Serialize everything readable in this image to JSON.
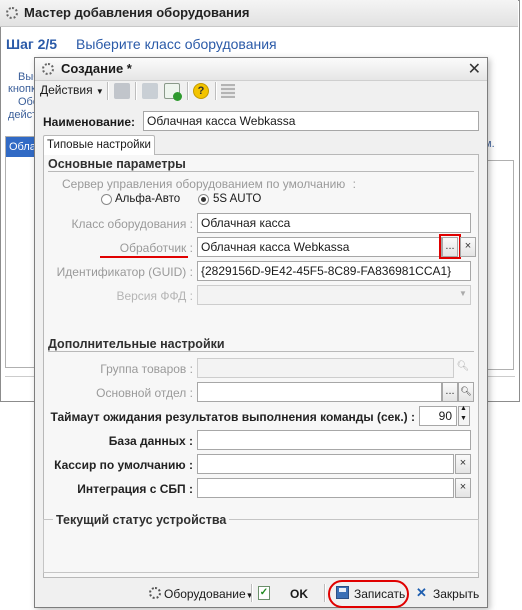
{
  "wizard": {
    "title": "Мастер добавления оборудования",
    "step": "Шаг 2/5",
    "step_text": "Выберите класс оборудования",
    "frag1": "Выб",
    "frag2": "кнопк",
    "frag3": "Обо",
    "frag4": "дейст",
    "frag_right": "м.",
    "left_selected": "Облач"
  },
  "dialog": {
    "title": "Создание *",
    "actions_label": "Действия",
    "name_label": "Наименование:",
    "name_value": "Облачная касса Webkassa",
    "tab_label": "Типовые настройки",
    "main_section": "Основные параметры",
    "server_label": "Сервер управления оборудованием по умолчанию",
    "radio1": "Альфа-Авто",
    "radio2": "5S AUTO",
    "class_label": "Класс оборудования",
    "class_value": "Облачная касса",
    "handler_label": "Обработчик",
    "handler_value": "Облачная касса Webkassa",
    "guid_label": "Идентификатор (GUID)",
    "guid_value": "{2829156D-9E42-45F5-8C89-FA836981CCA1}",
    "ffd_label": "Версия ФФД",
    "ffd_value": "",
    "extra_section": "Дополнительные настройки",
    "goods_group_label": "Группа товаров",
    "dept_label": "Основной отдел",
    "timeout_label": "Таймаут ожидания результатов выполнения команды (сек.)",
    "timeout_value": "90",
    "db_label": "База данных",
    "cashier_label": "Кассир по умолчанию",
    "sbp_label": "Интеграция с СБП",
    "status_section": "Текущий статус устройства",
    "equipment_label": "Оборудование",
    "ok_label": "OK",
    "save_label": "Записать",
    "close_label": "Закрыть",
    "colon": ":",
    "dots": "...",
    "x": "×",
    "close_title_glyph": "✕"
  },
  "colors": {
    "accent_blue": "#2a5aa8",
    "highlight_red": "#e00000",
    "selection": "#316ac5"
  }
}
